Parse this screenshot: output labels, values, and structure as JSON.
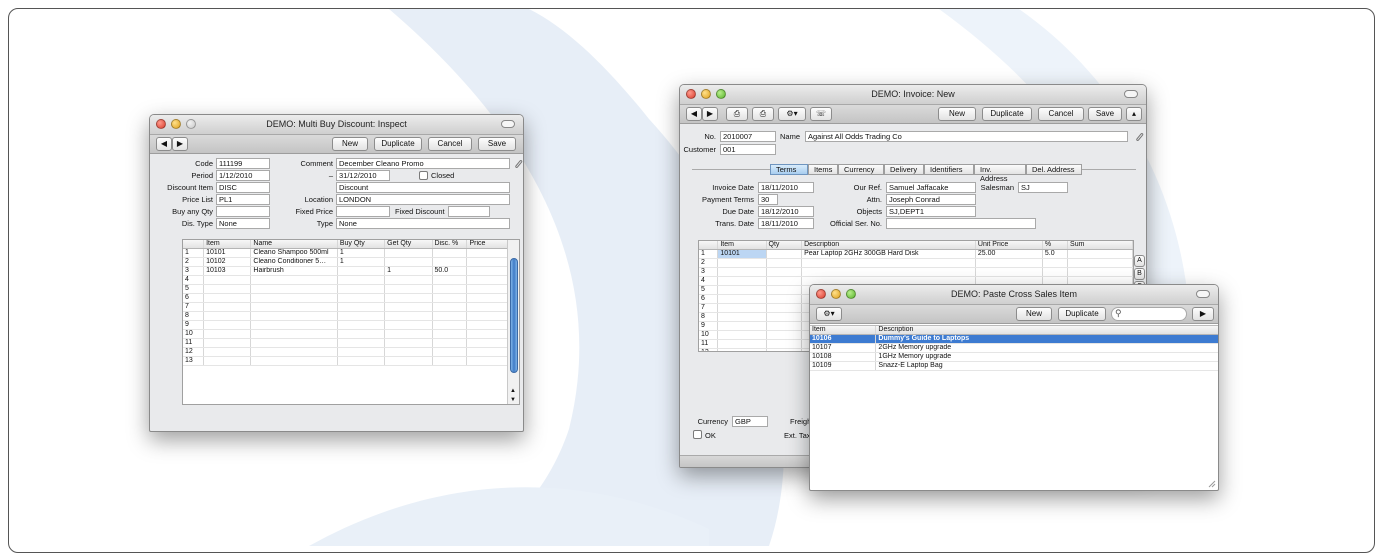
{
  "background": {
    "accent": "#e8eff8"
  },
  "discount_window": {
    "title": "DEMO: Multi Buy Discount: Inspect",
    "buttons": {
      "prev": "◀",
      "next": "▶",
      "new": "New",
      "duplicate": "Duplicate",
      "cancel": "Cancel",
      "save": "Save"
    },
    "labels": {
      "code": "Code",
      "comment": "Comment",
      "period": "Period",
      "dash": "–",
      "closed": "Closed",
      "discount_item": "Discount Item",
      "price_list": "Price List",
      "location": "Location",
      "buy_any_qty": "Buy any Qty",
      "fixed_price": "Fixed Price",
      "fixed_discount": "Fixed Discount",
      "dis_type": "Dis. Type",
      "type": "Type"
    },
    "values": {
      "code": "111199",
      "comment": "December Cleano Promo",
      "period_from": "1/12/2010",
      "period_to": "31/12/2010",
      "discount_item": "DISC",
      "discount_item_name": "Discount",
      "price_list": "PL1",
      "location": "LONDON",
      "buy_any_qty": "",
      "fixed_price": "",
      "fixed_discount": "",
      "dis_type": "None",
      "type": "None"
    },
    "columns": [
      "",
      "Item",
      "Name",
      "Buy Qty",
      "Get Qty",
      "Disc. %",
      "Price"
    ],
    "rows": [
      [
        "1",
        "10101",
        "Cleano Shampoo 500ml",
        "1",
        "",
        "",
        ""
      ],
      [
        "2",
        "10102",
        "Cleano Conditioner 5…",
        "1",
        "",
        "",
        ""
      ],
      [
        "3",
        "10103",
        "Hairbrush",
        "",
        "1",
        "50.0",
        ""
      ],
      [
        "4",
        "",
        "",
        "",
        "",
        "",
        ""
      ],
      [
        "5",
        "",
        "",
        "",
        "",
        "",
        ""
      ],
      [
        "6",
        "",
        "",
        "",
        "",
        "",
        ""
      ],
      [
        "7",
        "",
        "",
        "",
        "",
        "",
        ""
      ],
      [
        "8",
        "",
        "",
        "",
        "",
        "",
        ""
      ],
      [
        "9",
        "",
        "",
        "",
        "",
        "",
        ""
      ],
      [
        "10",
        "",
        "",
        "",
        "",
        "",
        ""
      ],
      [
        "11",
        "",
        "",
        "",
        "",
        "",
        ""
      ],
      [
        "12",
        "",
        "",
        "",
        "",
        "",
        ""
      ],
      [
        "13",
        "",
        "",
        "",
        "",
        "",
        ""
      ]
    ]
  },
  "invoice_window": {
    "title": "DEMO: Invoice: New",
    "buttons": {
      "new": "New",
      "duplicate": "Duplicate",
      "cancel": "Cancel",
      "save": "Save"
    },
    "labels": {
      "no": "No.",
      "name": "Name",
      "customer": "Customer",
      "invoice_date": "Invoice Date",
      "our_ref": "Our Ref.",
      "salesman": "Salesman",
      "payment_terms": "Payment Terms",
      "attn": "Attn.",
      "due_date": "Due Date",
      "objects": "Objects",
      "trans_date": "Trans. Date",
      "official_ser_no": "Official Ser. No.",
      "currency": "Currency",
      "freight": "Freight",
      "ok": "OK",
      "ext_tax": "Ext. Tax"
    },
    "values": {
      "no": "2010007",
      "name": "Against All Odds Trading Co",
      "customer": "001",
      "invoice_date": "18/11/2010",
      "our_ref": "Samuel Jaffacake",
      "salesman": "SJ",
      "payment_terms": "30",
      "attn": "Joseph Conrad",
      "due_date": "18/12/2010",
      "objects": "SJ,DEPT1",
      "trans_date": "18/11/2010",
      "official_ser_no": "",
      "currency": "GBP"
    },
    "tabs": [
      "Terms",
      "Items",
      "Currency",
      "Delivery",
      "Identifiers",
      "Inv. Address",
      "Del. Address"
    ],
    "columns": [
      "",
      "Item",
      "Qty",
      "Description",
      "Unit Price",
      "%",
      "Sum"
    ],
    "rows": [
      [
        "1",
        "10101",
        "",
        "Pear Laptop 2GHz 300GB Hard Disk",
        "25.00",
        "5.0",
        ""
      ],
      [
        "2",
        "",
        "",
        "",
        "",
        "",
        ""
      ],
      [
        "3",
        "",
        "",
        "",
        "",
        "",
        ""
      ],
      [
        "4",
        "",
        "",
        "",
        "",
        "",
        ""
      ],
      [
        "5",
        "",
        "",
        "",
        "",
        "",
        ""
      ],
      [
        "6",
        "",
        "",
        "",
        "",
        "",
        ""
      ],
      [
        "7",
        "",
        "",
        "",
        "",
        "",
        ""
      ],
      [
        "8",
        "",
        "",
        "",
        "",
        "",
        ""
      ],
      [
        "9",
        "",
        "",
        "",
        "",
        "",
        ""
      ],
      [
        "10",
        "",
        "",
        "",
        "",
        "",
        ""
      ],
      [
        "11",
        "",
        "",
        "",
        "",
        "",
        ""
      ],
      [
        "12",
        "",
        "",
        "",
        "",
        "",
        ""
      ],
      [
        "13",
        "",
        "",
        "",
        "",
        "",
        ""
      ]
    ],
    "row_tags": [
      "A",
      "B",
      "C"
    ]
  },
  "paste_window": {
    "title": "DEMO: Paste Cross Sales Item",
    "buttons": {
      "new": "New",
      "duplicate": "Duplicate",
      "go": "▶"
    },
    "search_value": "",
    "columns": [
      "Item",
      "Description"
    ],
    "rows": [
      [
        "10106",
        "Dummy's Guide to Laptops"
      ],
      [
        "10107",
        "2GHz Memory upgrade"
      ],
      [
        "10108",
        "1GHz Memory upgrade"
      ],
      [
        "10109",
        "Snazz-E Laptop Bag"
      ]
    ]
  }
}
